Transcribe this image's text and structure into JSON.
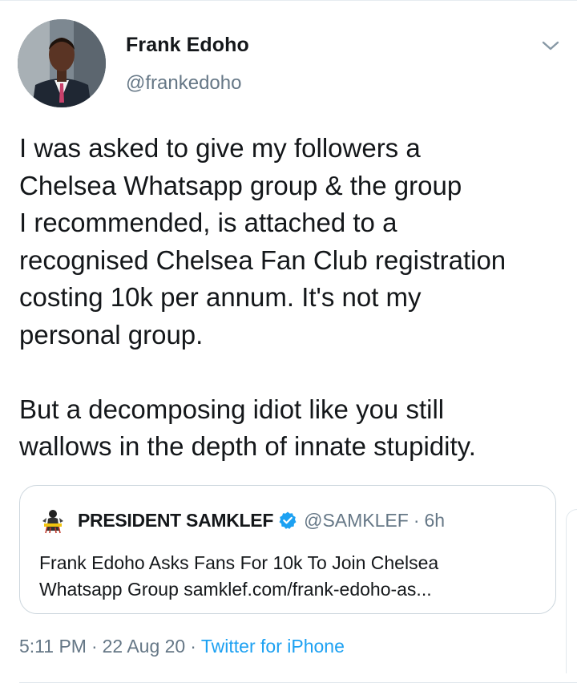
{
  "author": {
    "display_name": "Frank Edoho",
    "handle": "@frankedoho"
  },
  "tweet": {
    "lines": [
      "I was asked to give my followers a",
      "Chelsea Whatsapp group & the group",
      "I recommended, is attached to a",
      "recognised Chelsea Fan Club registration",
      "costing 10k per annum. It's not my",
      "personal group.",
      "But a decomposing idiot like you still",
      "wallows in the depth of innate stupidity."
    ]
  },
  "quoted": {
    "display_name": "PRESIDENT SAMKLEF",
    "handle": "@SAMKLEF",
    "separator": "·",
    "time": "6h",
    "lines": [
      "Frank Edoho Asks Fans For 10k To Join Chelsea",
      "Whatsapp Group samklef.com/frank-edoho-as..."
    ],
    "verified": true
  },
  "meta": {
    "time": "5:11 PM",
    "sep1": "·",
    "date": "22 Aug 20",
    "sep2": "·",
    "source": "Twitter for iPhone"
  },
  "icons": {
    "caret": "chevron-down-icon",
    "verified": "verified-badge-icon",
    "quote_logo": "samklef-logo-icon"
  },
  "colors": {
    "accent": "#1da1f2",
    "secondary_text": "#657786",
    "border": "#ccd6dd"
  }
}
